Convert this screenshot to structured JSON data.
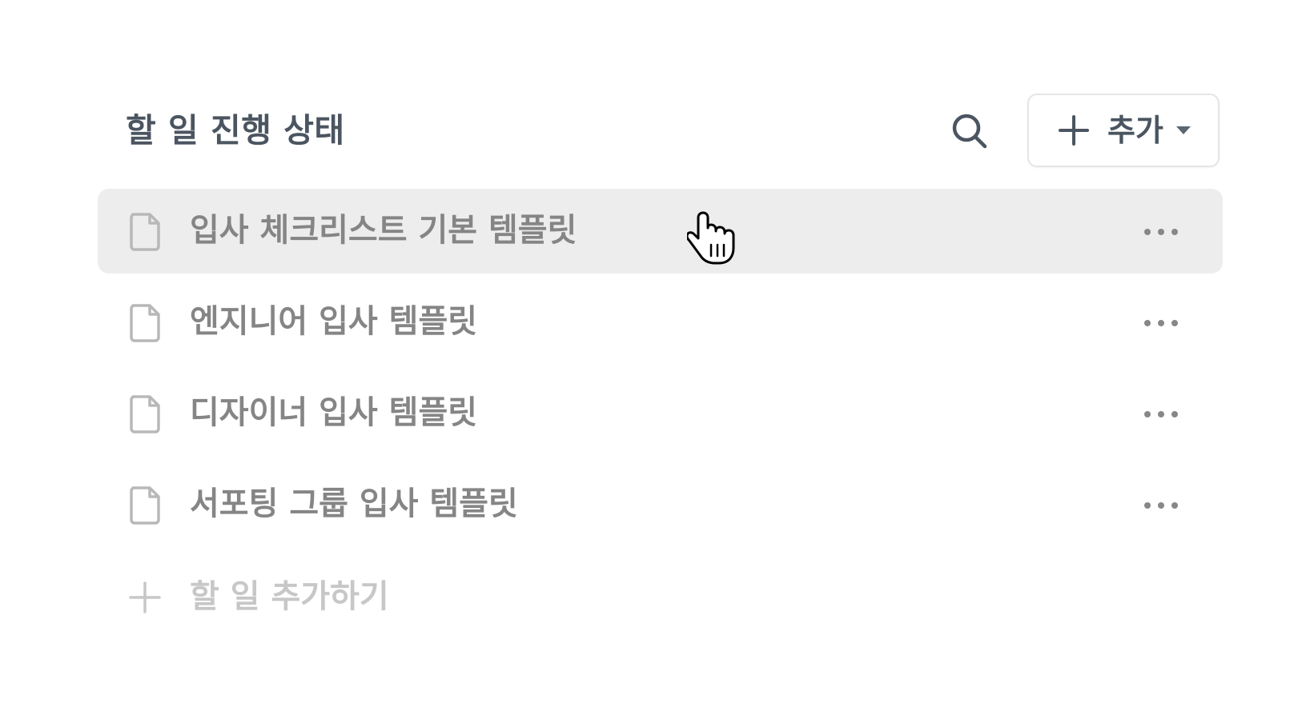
{
  "header": {
    "title": "할 일 진행 상태",
    "add_button_label": "추가"
  },
  "icons": {
    "search": "search-icon",
    "plus": "plus-icon",
    "caret": "caret-down-icon",
    "document": "document-icon",
    "more": "more-horizontal-icon",
    "cursor": "hand-pointer-cursor"
  },
  "list": {
    "items": [
      {
        "label": "입사 체크리스트 기본 템플릿",
        "hovered": true
      },
      {
        "label": "엔지니어 입사 템플릿",
        "hovered": false
      },
      {
        "label": "디자이너 입사 템플릿",
        "hovered": false
      },
      {
        "label": "서포팅 그룹 입사 템플릿",
        "hovered": false
      }
    ]
  },
  "footer": {
    "add_task_label": "할 일 추가하기"
  },
  "colors": {
    "title": "#4b5561",
    "row_text": "#858585",
    "row_hover_bg": "#ecedec",
    "muted": "#c7c7c7",
    "border": "#e3e5e8"
  }
}
